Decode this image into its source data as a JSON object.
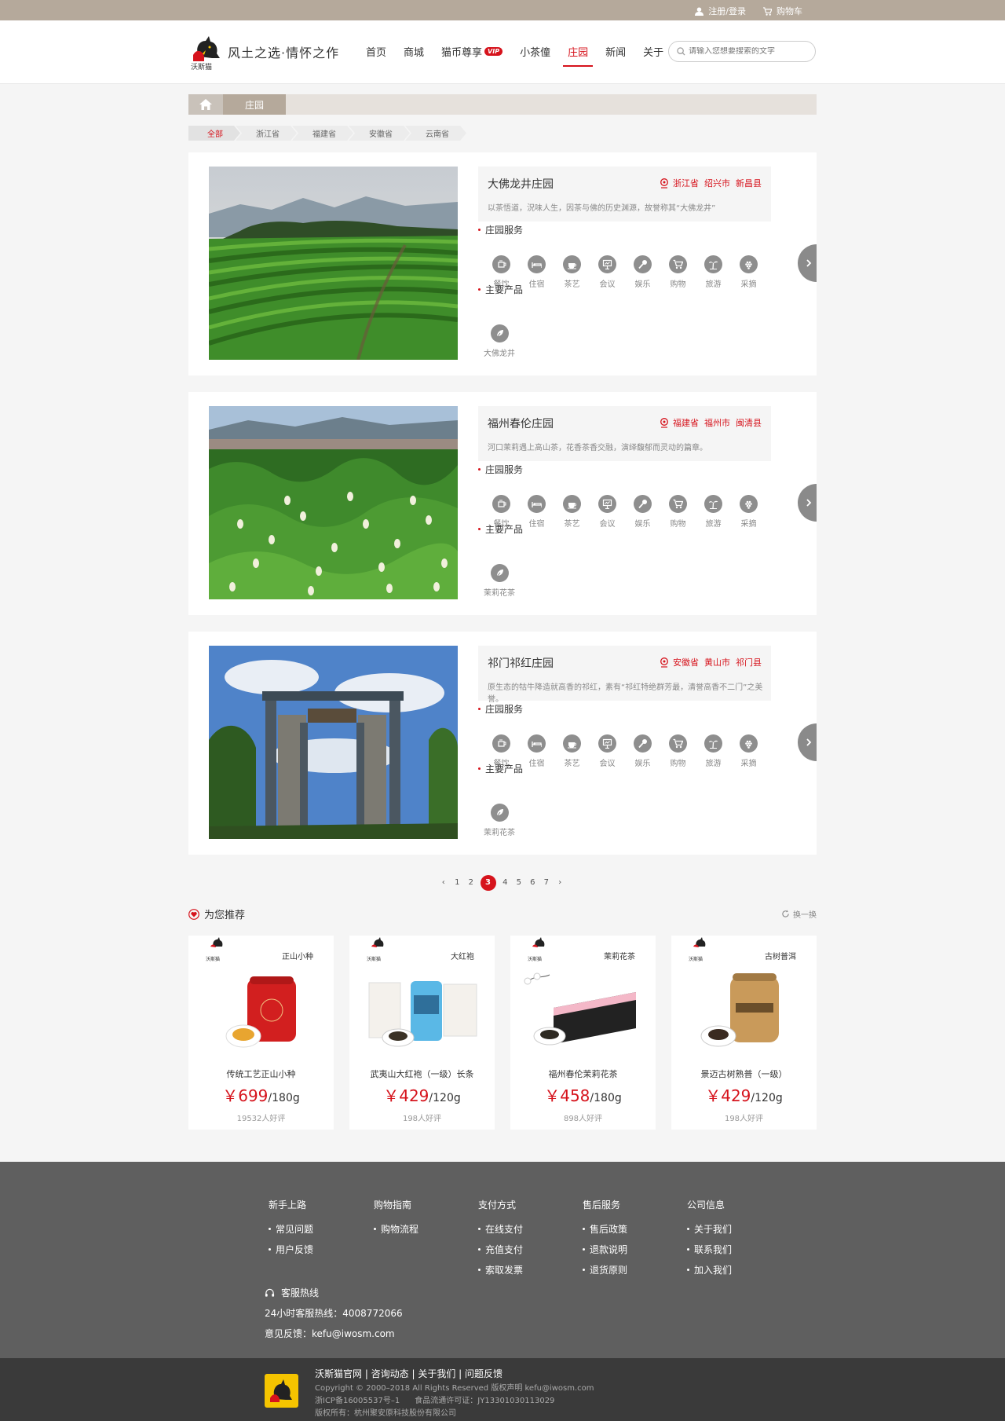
{
  "topbar": {
    "login": "注册/登录",
    "cart": "购物车"
  },
  "header": {
    "logo_text": "沃斯猫",
    "slogan": "风土之选·情怀之作",
    "nav": [
      {
        "label": "首页"
      },
      {
        "label": "商城"
      },
      {
        "label": "猫币尊享",
        "badge": "VIP"
      },
      {
        "label": "小茶僮"
      },
      {
        "label": "庄园",
        "active": true
      },
      {
        "label": "新闻"
      },
      {
        "label": "关于"
      }
    ],
    "search_placeholder": "请输入您想要搜索的文字"
  },
  "breadcrumb": {
    "current": "庄园"
  },
  "filters": [
    {
      "label": "全部",
      "active": true
    },
    {
      "label": "浙江省"
    },
    {
      "label": "福建省"
    },
    {
      "label": "安徽省"
    },
    {
      "label": "云南省"
    }
  ],
  "labels": {
    "services": "庄园服务",
    "products": "主要产品"
  },
  "services": [
    {
      "label": "餐饮",
      "icon": "dining-icon"
    },
    {
      "label": "住宿",
      "icon": "bed-icon"
    },
    {
      "label": "茶艺",
      "icon": "tea-cup-icon"
    },
    {
      "label": "会议",
      "icon": "presentation-icon"
    },
    {
      "label": "娱乐",
      "icon": "microphone-icon"
    },
    {
      "label": "购物",
      "icon": "cart-icon"
    },
    {
      "label": "旅游",
      "icon": "palm-tree-icon"
    },
    {
      "label": "采摘",
      "icon": "grapes-icon"
    }
  ],
  "estates": [
    {
      "name": "大佛龙井庄园",
      "location": "浙江省  绍兴市  新昌县",
      "desc": "以茶悟道，況味人生，因茶与佛的历史渊源，故誉称其“大佛龙井”",
      "product": "大佛龙井"
    },
    {
      "name": "福州春伦庄园",
      "location": "福建省  福州市  闽清县",
      "desc": "河口茉莉遇上高山茶，花香茶香交融，演绎馥郁而灵动的篇章。",
      "product": "茉莉花茶"
    },
    {
      "name": "祁门祁红庄园",
      "location": "安徽省  黄山市  祁门县",
      "desc": "原生态的牯牛降造就高香的祁红，素有“祁红特绝群芳最，清誉高香不二门”之美誉。",
      "product": "茉莉花茶"
    }
  ],
  "pagination": {
    "pages": [
      "1",
      "2",
      "3",
      "4",
      "5",
      "6",
      "7"
    ],
    "current": "3"
  },
  "recommend": {
    "title": "为您推荐",
    "refresh": "换一换",
    "items": [
      {
        "name": "传统工艺正山小种",
        "price": "￥699",
        "unit": "/180g",
        "reviews": "19532人好评",
        "box_title": "正山小种",
        "brand": "沃斯猫"
      },
      {
        "name": "武夷山大红袍（一级）长条",
        "price": "￥429",
        "unit": "/120g",
        "reviews": "198人好评",
        "box_title": "大红袍",
        "brand": "沃斯猫"
      },
      {
        "name": "福州春伦茉莉花茶",
        "price": "￥458",
        "unit": "/180g",
        "reviews": "898人好评",
        "box_title": "茉莉花茶",
        "brand": "沃斯猫"
      },
      {
        "name": "景迈古树熟普（一级）",
        "price": "￥429",
        "unit": "/120g",
        "reviews": "198人好评",
        "box_title": "古树普洱",
        "brand": "沃斯猫"
      }
    ]
  },
  "footer": {
    "columns": [
      {
        "title": "新手上路",
        "items": [
          "常见问题",
          "用户反馈"
        ]
      },
      {
        "title": "购物指南",
        "items": [
          "购物流程"
        ]
      },
      {
        "title": "支付方式",
        "items": [
          "在线支付",
          "充值支付",
          "索取发票"
        ]
      },
      {
        "title": "售后服务",
        "items": [
          "售后政策",
          "退款说明",
          "退货原则"
        ]
      },
      {
        "title": "公司信息",
        "items": [
          "关于我们",
          "联系我们",
          "加入我们"
        ]
      }
    ],
    "hotline_title": "客服热线",
    "hotline": "24小时客服热线：4008772066",
    "feedback": "意见反馈：kefu@iwosm.com"
  },
  "bottom": {
    "links": "沃斯猫官网 | 咨询动态 | 关于我们 | 问题反馈",
    "copyright": "Copyright © 2000–2018 All Rights Reserved 版权声明 kefu@iwosm.com",
    "icp": "浙ICP备16005537号–1      食品流通许可证：JY13301030113029",
    "owner": "版权所有：杭州聚安原科技股份有限公司"
  },
  "colors": {
    "accent": "#d6131c",
    "topbar": "#b5a99b",
    "footer": "#5f5f5f"
  }
}
